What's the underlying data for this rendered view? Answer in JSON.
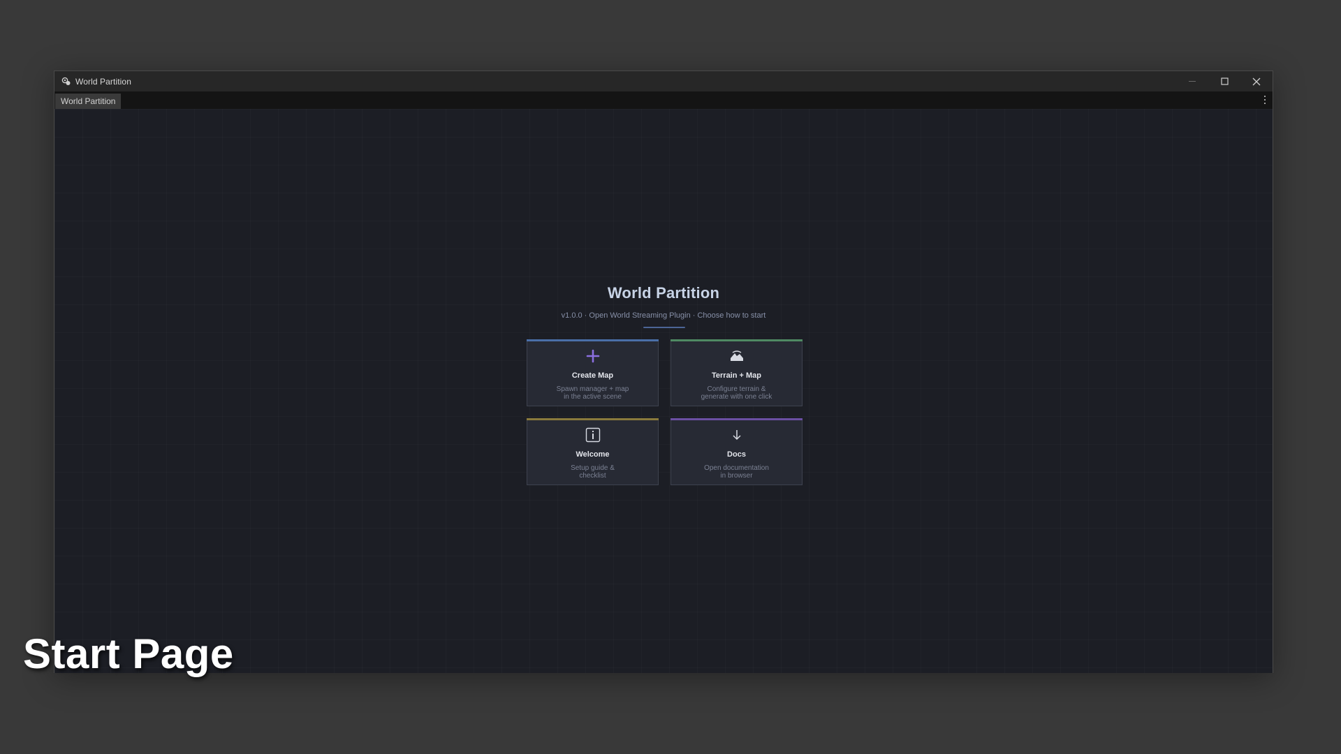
{
  "window": {
    "title": "World Partition",
    "tab_label": "World Partition"
  },
  "start": {
    "heading": "World Partition",
    "subtitle": "v1.0.0  ·  Open World Streaming Plugin  ·  Choose how to start",
    "cards": [
      {
        "name": "Create Map",
        "desc": "Spawn manager + map\nin the active scene",
        "icon": "plus-icon",
        "accent": "#4a6fa8"
      },
      {
        "name": "Terrain + Map",
        "desc": "Configure terrain &\ngenerate with one click",
        "icon": "terrain-icon",
        "accent": "#4f8a63"
      },
      {
        "name": "Welcome",
        "desc": "Setup guide &\nchecklist",
        "icon": "info-icon",
        "accent": "#8a7a3c"
      },
      {
        "name": "Docs",
        "desc": "Open documentation\nin browser",
        "icon": "download-arrow-icon",
        "accent": "#6b4fa3"
      }
    ]
  },
  "caption": "Start Page",
  "colors": {
    "background": "#393939",
    "panel": "#1c1e25",
    "card": "#272a34",
    "plus_icon": "#8b6fe0"
  }
}
